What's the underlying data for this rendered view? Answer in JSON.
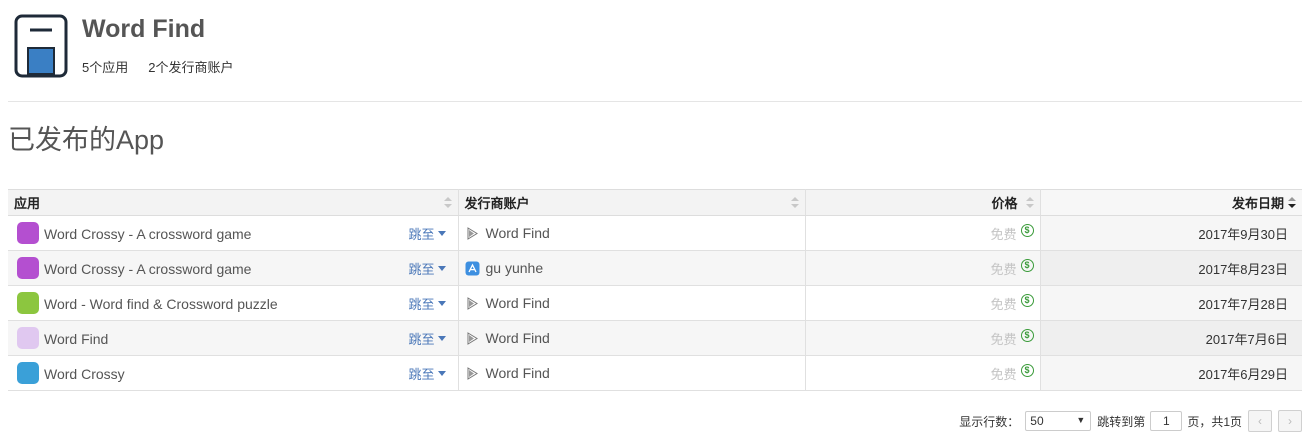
{
  "publisher": {
    "name": "Word Find",
    "app_count": "5个应用",
    "account_count": "2个发行商账户"
  },
  "section_title": "已发布的App",
  "table": {
    "headers": {
      "app": "应用",
      "publisher": "发行商账户",
      "price": "价格",
      "date": "发布日期"
    },
    "rows": [
      {
        "name": "Word Crossy - A crossword game",
        "jump": "跳至",
        "store": "google-play",
        "store_icon": "google-play-icon",
        "publisher": "Word Find",
        "price": "免费",
        "date": "2017年9月30日",
        "icon_color": "#b44fd0"
      },
      {
        "name": "Word Crossy - A crossword game",
        "jump": "跳至",
        "store": "app-store",
        "store_icon": "app-store-icon",
        "publisher": "gu yunhe",
        "price": "免费",
        "date": "2017年8月23日",
        "icon_color": "#b44fd0"
      },
      {
        "name": "Word - Word find & Crossword puzzle",
        "jump": "跳至",
        "store": "google-play",
        "store_icon": "google-play-icon",
        "publisher": "Word Find",
        "price": "免费",
        "date": "2017年7月28日",
        "icon_color": "#8cc63f"
      },
      {
        "name": "Word Find",
        "jump": "跳至",
        "store": "google-play",
        "store_icon": "google-play-icon",
        "publisher": "Word Find",
        "price": "免费",
        "date": "2017年7月6日",
        "icon_color": "#e0c8f0"
      },
      {
        "name": "Word Crossy",
        "jump": "跳至",
        "store": "google-play",
        "store_icon": "google-play-icon",
        "publisher": "Word Find",
        "price": "免费",
        "date": "2017年6月29日",
        "icon_color": "#3aa0d8"
      }
    ]
  },
  "pagination": {
    "rows_label": "显示行数：",
    "rows_value": "50",
    "jump_label": "跳转到第",
    "page_value": "1",
    "page_suffix": "页，共1页",
    "prev": "‹",
    "next": "›"
  },
  "colors": {
    "link": "#4a77b8",
    "price_icon": "#3a9b3a",
    "logo_blue": "#3a7fc4"
  }
}
